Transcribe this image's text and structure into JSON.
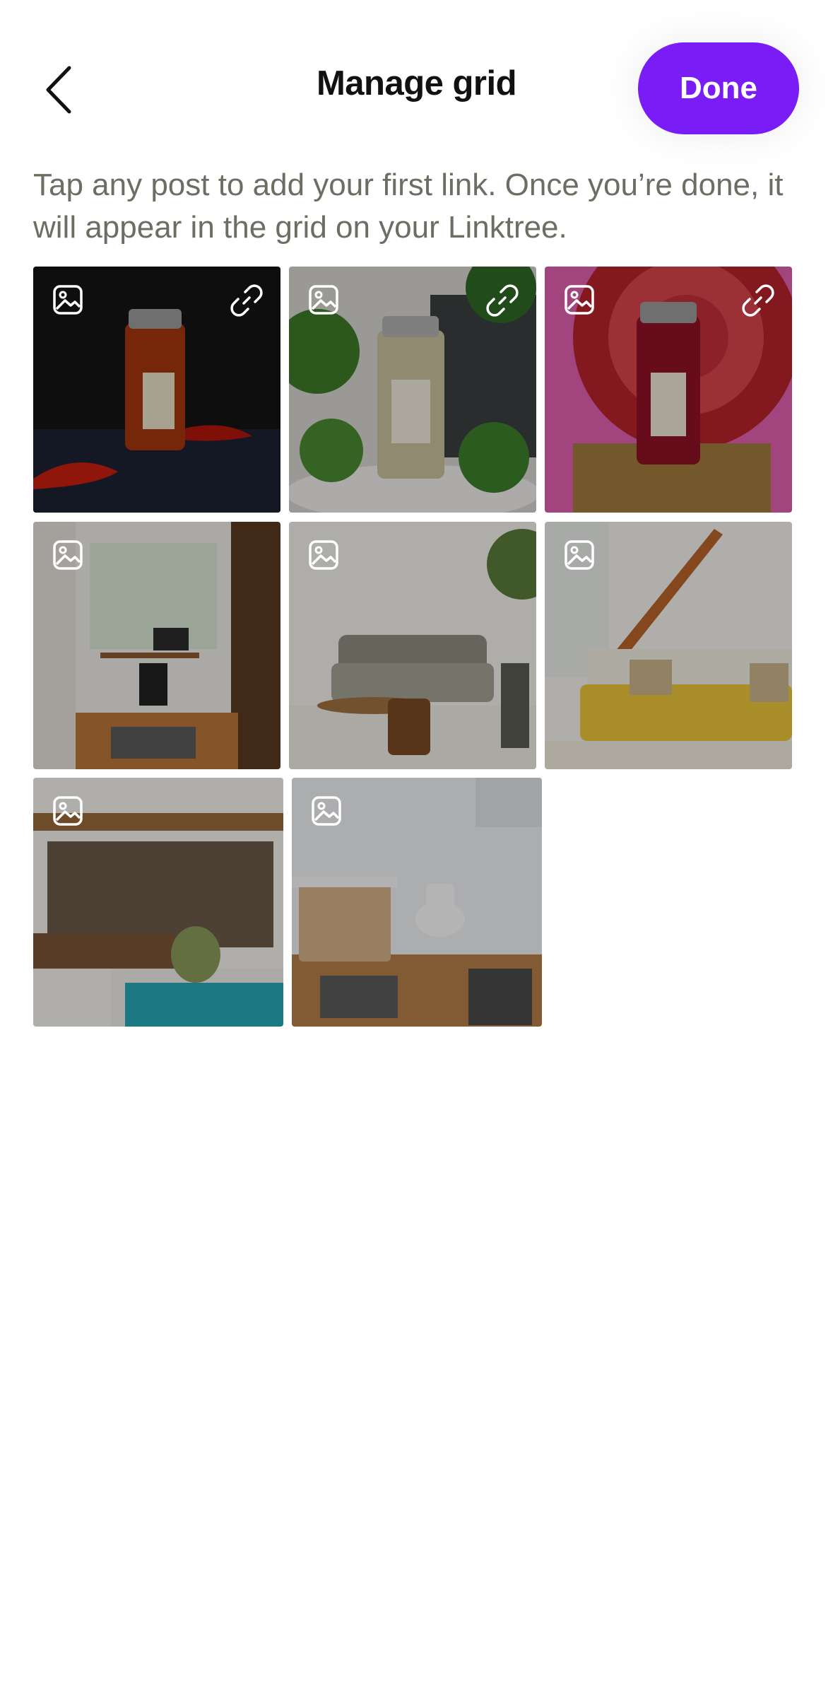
{
  "header": {
    "back_label": "Back",
    "title": "Manage grid",
    "done_label": "Done"
  },
  "instructions": "Tap any post to add your first link. Once you’re done, it will appear in the grid on your Linktree.",
  "colors": {
    "accent": "#7A1CF5",
    "text_primary": "#111111",
    "text_secondary": "#6D6D64"
  },
  "grid": {
    "posts": [
      {
        "subject": "chili flakes spice jar",
        "has_link_icon": true
      },
      {
        "subject": "thyme spice jar with greenery",
        "has_link_icon": true
      },
      {
        "subject": "red spice jar with patterned plate",
        "has_link_icon": true
      },
      {
        "subject": "home office",
        "has_link_icon": false
      },
      {
        "subject": "living room with grey sofa",
        "has_link_icon": false
      },
      {
        "subject": "living room with yellow sofa and staircase",
        "has_link_icon": false
      },
      {
        "subject": "patio with pool",
        "has_link_icon": false
      },
      {
        "subject": "bathroom",
        "has_link_icon": false
      }
    ],
    "image_icon": "image-icon",
    "link_icon": "link-icon"
  }
}
